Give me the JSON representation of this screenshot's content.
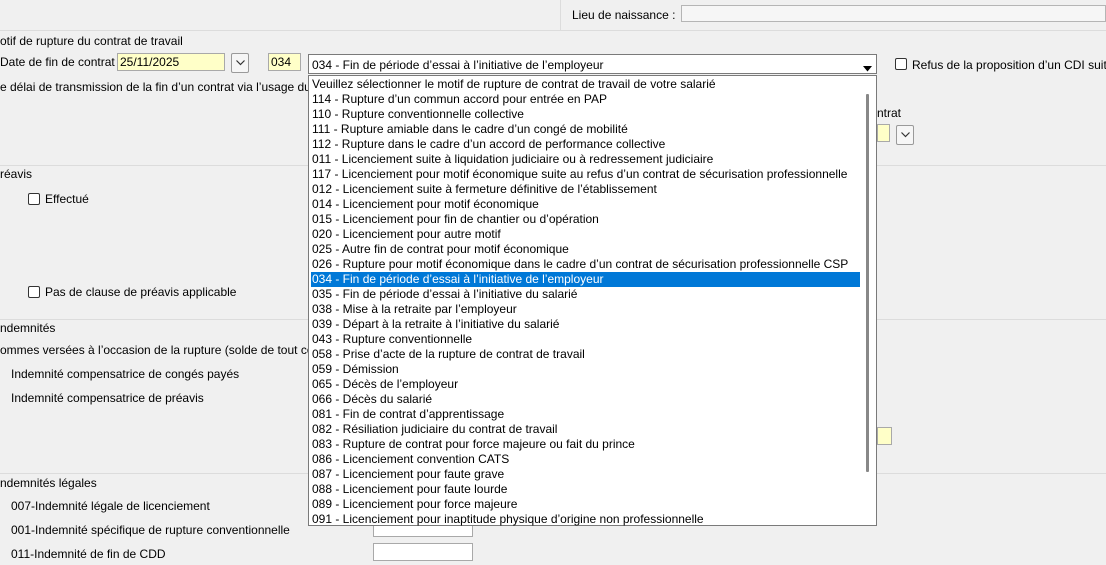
{
  "top": {
    "birthplace_label": "Lieu de naissance :"
  },
  "motif": {
    "section_title": "otif de rupture du contrat de travail",
    "end_date_label": "Date de fin de contrat :",
    "end_date_value": "25/11/2025",
    "code_value": "034",
    "select_value": "034 - Fin de période d’essai à l’initiative de l’employeur",
    "refus_cdi_label": "Refus de la proposition d’un CDI suite à C",
    "transmission_text": "e délai de transmission de la fin d’un contrat via l’usage du signal",
    "contrat_label": "ntrat"
  },
  "preavis": {
    "section_title": "réavis",
    "effectue_label": "Effectué",
    "pas_clause_label": "Pas de clause de préavis applicable"
  },
  "indemnites": {
    "section_title": "ndemnités",
    "sommes_label": "ommes versées à l’occasion de la rupture (solde de tout compte)",
    "conges_label": "Indemnité compensatrice de congés payés",
    "preavis_label": "Indemnité compensatrice de préavis"
  },
  "legales": {
    "section_title": "ndemnités légales",
    "items": [
      "007-Indemnité légale de licenciement",
      "001-Indemnité spécifique de rupture conventionnelle",
      "011-Indemnité de fin de CDD"
    ]
  },
  "dropdown": {
    "selected_index": 14,
    "options": [
      "Veuillez sélectionner le motif de rupture de contrat de travail de votre salarié",
      "114 - Rupture d’un commun accord pour entrée en PAP",
      "110 - Rupture conventionnelle collective",
      "111 - Rupture amiable dans le cadre d’un congé de mobilité",
      "112 - Rupture dans le cadre d’un accord de performance collective",
      "011 - Licenciement suite à liquidation judiciaire ou à redressement judiciaire",
      "117 - Licenciement pour motif économique suite au refus d’un contrat de sécurisation professionnelle",
      "012 - Licenciement suite à fermeture définitive de l’établissement",
      "014 - Licenciement pour motif économique",
      "015 - Licenciement pour fin de chantier ou d’opération",
      "020 - Licenciement pour autre motif",
      "025 - Autre fin de contrat pour motif économique",
      "026 - Rupture pour motif économique dans le cadre d’un contrat de sécurisation professionnelle CSP",
      "034 - Fin de période d’essai à l’initiative de l’employeur",
      "035 - Fin de période d’essai à l’initiative du salarié",
      "038 - Mise à la retraite par l’employeur",
      "039 - Départ à la retraite à l’initiative du salarié",
      "043 - Rupture conventionnelle",
      "058 - Prise d’acte de la rupture de contrat de travail",
      "059 - Démission",
      "065 - Décès de l’employeur",
      "066 - Décès du salarié",
      "081 - Fin de contrat d’apprentissage",
      "082 - Résiliation judiciaire du contrat de travail",
      "083 - Rupture de contrat pour force majeure ou fait du prince",
      "086 - Licenciement convention CATS",
      "087 - Licenciement pour faute grave",
      "088 - Licenciement pour faute lourde",
      "089 - Licenciement pour force majeure",
      "091 - Licenciement pour inaptitude physique d’origine non professionnelle"
    ]
  },
  "colors": {
    "selection": "#0078d7",
    "yellow_field": "#ffffc8"
  },
  "icons": {
    "dropdown_arrow": "chevron-down-icon"
  }
}
